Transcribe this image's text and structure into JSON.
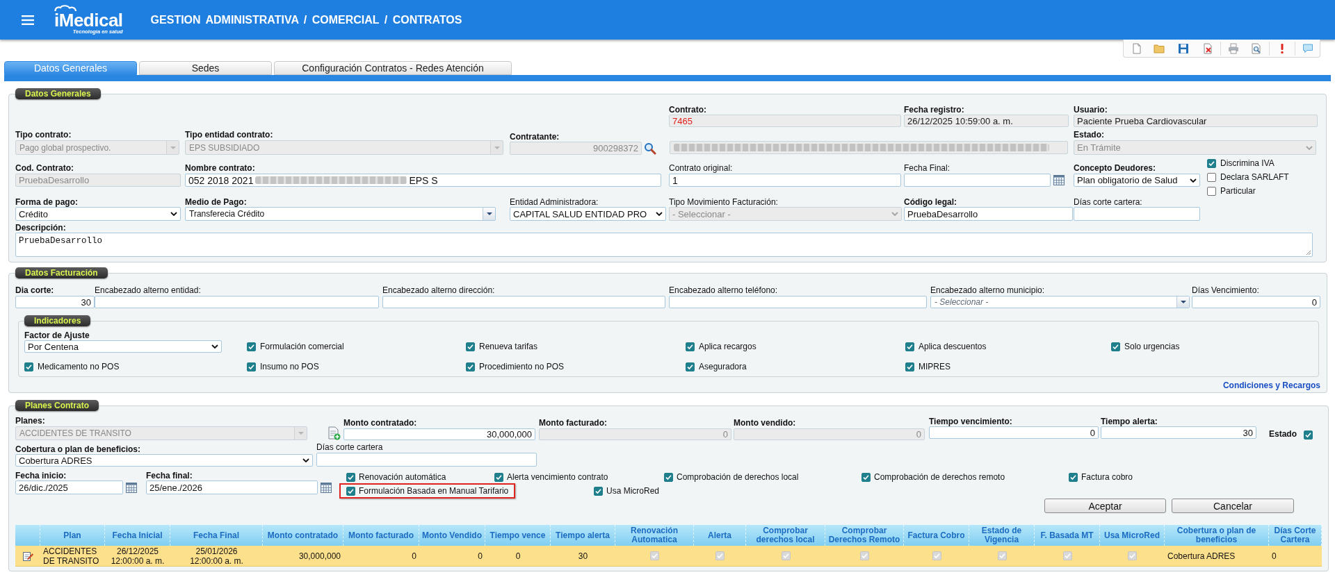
{
  "header": {
    "logo_text": "iMedical",
    "logo_tagline": "Tecnología en salud",
    "title": "GESTION ADMINISTRATIVA / COMERCIAL / CONTRATOS"
  },
  "tabs": [
    {
      "label": "Datos Generales",
      "selected": true
    },
    {
      "label": "Sedes",
      "selected": false
    },
    {
      "label": "Configuración Contratos - Redes Atención",
      "selected": false
    }
  ],
  "datos_generales": {
    "legend": "Datos Generales",
    "contrato": {
      "label": "Contrato:",
      "value": "7465",
      "readonly": true,
      "disabled": false
    },
    "fecha_registro": {
      "label": "Fecha registro:",
      "value": "26/12/2025 10:59:00 a. m.",
      "readonly": true,
      "disabled": false
    },
    "usuario": {
      "label": "Usuario:",
      "value": "Paciente Prueba Cardiovascular",
      "readonly": true,
      "disabled": false
    },
    "tipo_contrato": {
      "label": "Tipo contrato:",
      "value": "Pago global prospectivo.",
      "disabled": true
    },
    "tipo_entidad_contrato": {
      "label": "Tipo entidad contrato:",
      "value": "EPS SUBSIDIADO",
      "disabled": true
    },
    "contratante": {
      "label": "Contratante:",
      "value": "900298372",
      "disabled": true
    },
    "contratante_nombre": {
      "disabled": true,
      "redacted": true
    },
    "estado": {
      "label": "Estado:",
      "value": "En Trámite",
      "disabled": true
    },
    "cod_contrato": {
      "label": "Cod. Contrato:",
      "value": "PruebaDesarrollo",
      "disabled": true
    },
    "nombre_contrato": {
      "label": "Nombre contrato:",
      "value_parts": [
        "052 2018 2021",
        "EPS S"
      ],
      "redacted": true,
      "disabled": false
    },
    "contrato_original": {
      "label": "Contrato original:",
      "value": "1",
      "disabled": false
    },
    "fecha_final": {
      "label": "Fecha Final:",
      "disabled": false
    },
    "concepto_deudores": {
      "label": "Concepto Deudores:",
      "value": "Plan obligatorio de Salud",
      "disabled": false
    },
    "opciones": [
      {
        "label": "Discrimina IVA",
        "checked": true
      },
      {
        "label": "Declara SARLAFT",
        "checked": false
      },
      {
        "label": "Particular",
        "checked": false
      }
    ],
    "forma_pago": {
      "label": "Forma de pago:",
      "value": "Crédito",
      "disabled": false
    },
    "medio_pago": {
      "label": "Medio de Pago:",
      "value": "Transferecia Crédito",
      "disabled": false
    },
    "entidad_administradora": {
      "label": "Entidad Administradora:",
      "value": "CAPITAL SALUD ENTIDAD PRO",
      "disabled": false
    },
    "tipo_movimiento_facturacion": {
      "label": "Tipo Movimiento Facturación:",
      "value": "- Seleccionar -",
      "disabled": true
    },
    "codigo_legal": {
      "label": "Código legal:",
      "value": "PruebaDesarrollo",
      "disabled": false
    },
    "dias_corte_cartera": {
      "label": "Días corte cartera:",
      "disabled": false
    },
    "descripcion": {
      "label": "Descripción:",
      "value": "PruebaDesarrollo",
      "disabled": false
    }
  },
  "datos_facturacion": {
    "legend": "Datos Facturación",
    "dia_corte": {
      "label": "Dia corte:",
      "value": "30",
      "disabled": false
    },
    "encabezado_entidad": {
      "label": "Encabezado alterno entidad:",
      "disabled": false
    },
    "encabezado_direccion": {
      "label": "Encabezado alterno dirección:",
      "disabled": false
    },
    "encabezado_telefono": {
      "label": "Encabezado alterno teléfono:",
      "disabled": false
    },
    "encabezado_municipio": {
      "label": "Encabezado alterno municipio:",
      "placeholder": "- Seleccionar -",
      "disabled": false
    },
    "dias_vencimiento": {
      "label": "Días Vencimiento:",
      "value": "0",
      "disabled": false
    },
    "indicadores": {
      "legend": "Indicadores",
      "factor_ajuste": {
        "label": "Factor de Ajuste",
        "value": "Por Centena",
        "disabled": false
      },
      "opciones": [
        {
          "label": "Formulación comercial",
          "checked": true
        },
        {
          "label": "Renueva tarifas",
          "checked": true
        },
        {
          "label": "Aplica recargos",
          "checked": true
        },
        {
          "label": "Aplica descuentos",
          "checked": true
        },
        {
          "label": "Solo urgencias",
          "checked": true
        },
        {
          "label": "Medicamento no POS",
          "checked": true
        },
        {
          "label": "Insumo no POS",
          "checked": true
        },
        {
          "label": "Procedimiento no POS",
          "checked": true
        },
        {
          "label": "Aseguradora",
          "checked": true
        },
        {
          "label": "MIPRES",
          "checked": true
        }
      ]
    },
    "condiciones_link": "Condiciones y Recargos"
  },
  "planes_contrato": {
    "legend": "Planes Contrato",
    "planes": {
      "label": "Planes:",
      "value": "ACCIDENTES DE TRANSITO",
      "disabled": true
    },
    "monto_contratado": {
      "label": "Monto contratado:",
      "value": "30,000,000",
      "disabled": false
    },
    "monto_facturado": {
      "label": "Monto facturado:",
      "value": "0",
      "disabled": true
    },
    "monto_vendido": {
      "label": "Monto vendido:",
      "value": "0",
      "disabled": true
    },
    "tiempo_vencimiento": {
      "label": "Tiempo vencimiento:",
      "value": "0",
      "disabled": false
    },
    "tiempo_alerta": {
      "label": "Tiempo alerta:",
      "value": "30",
      "disabled": false
    },
    "estado": {
      "label": "Estado",
      "checked": true
    },
    "cobertura": {
      "label": "Cobertura o plan de beneficios:",
      "value": "Cobertura ADRES",
      "disabled": false
    },
    "dias_corte_cartera": {
      "label": "Días corte cartera",
      "disabled": false
    },
    "fecha_inicio": {
      "label": "Fecha inicio:",
      "value": "26/dic./2025",
      "disabled": false
    },
    "fecha_final": {
      "label": "Fecha final:",
      "value": "25/ene./2026",
      "disabled": false
    },
    "opciones": [
      {
        "label": "Renovación automática",
        "checked": true,
        "highlighted": false
      },
      {
        "label": "Alerta vencimiento contrato",
        "checked": true,
        "highlighted": false
      },
      {
        "label": "Comprobación de derechos local",
        "checked": true,
        "highlighted": false
      },
      {
        "label": "Comprobación de derechos remoto",
        "checked": true,
        "highlighted": false
      },
      {
        "label": "Factura cobro",
        "checked": true,
        "highlighted": false
      },
      {
        "label": "Formulación Basada en Manual Tarifario",
        "checked": true,
        "highlighted": true
      },
      {
        "label": "Usa MicroRed",
        "checked": true,
        "highlighted": false
      }
    ],
    "buttons": [
      "Aceptar",
      "Cancelar"
    ],
    "table": {
      "columns": [
        "Plan",
        "Fecha Inicial",
        "Fecha Final",
        "Monto contratado",
        "Monto facturado",
        "Monto Vendido",
        "Tiempo vence",
        "Tiempo alerta",
        "Renovación Automatica",
        "Alerta",
        "Comprobar derechos local",
        "Comprobar Derechos Remoto",
        "Factura Cobro",
        "Estado de Vigencia",
        "F. Basada MT",
        "Usa MicroRed",
        "Cobertura o plan de beneficios",
        "Días Corte Cartera"
      ],
      "rows": [
        {
          "cells": [
            {
              "kind": "text",
              "text": "ACCIDENTES DE TRANSITO"
            },
            {
              "kind": "text",
              "text": "26/12/2025 12:00:00 a. m."
            },
            {
              "kind": "text",
              "text": "25/01/2026 12:00:00 a. m."
            },
            {
              "kind": "text",
              "text": "30,000,000"
            },
            {
              "kind": "text",
              "text": "0"
            },
            {
              "kind": "text",
              "text": "0"
            },
            {
              "kind": "text",
              "text": "0"
            },
            {
              "kind": "text",
              "text": "30"
            },
            {
              "kind": "check",
              "checked": true,
              "disabled": true
            },
            {
              "kind": "check",
              "checked": true,
              "disabled": true
            },
            {
              "kind": "check",
              "checked": true,
              "disabled": true
            },
            {
              "kind": "check",
              "checked": true,
              "disabled": true
            },
            {
              "kind": "check",
              "checked": true,
              "disabled": true
            },
            {
              "kind": "check",
              "checked": true,
              "disabled": true
            },
            {
              "kind": "check",
              "checked": true,
              "disabled": true
            },
            {
              "kind": "check",
              "checked": true,
              "disabled": true
            },
            {
              "kind": "text",
              "text": "Cobertura ADRES"
            },
            {
              "kind": "text",
              "text": "0"
            }
          ]
        }
      ]
    }
  }
}
